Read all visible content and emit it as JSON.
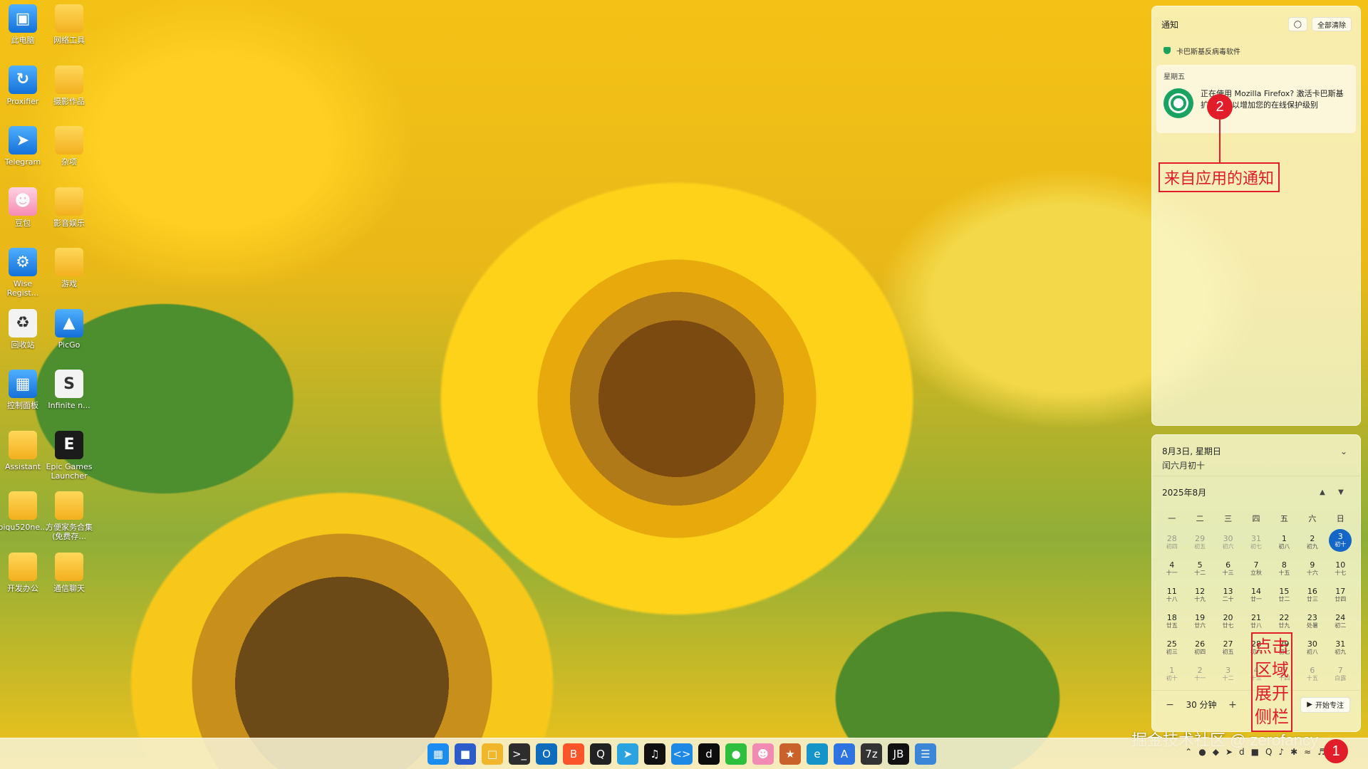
{
  "desktop": {
    "icons": [
      {
        "label": "此电脑",
        "icon": "computer-icon"
      },
      {
        "label": "网络工具",
        "icon": "folder-icon"
      },
      {
        "label": "Proxifier",
        "icon": "proxifier-icon"
      },
      {
        "label": "摄影作品",
        "icon": "folder-icon"
      },
      {
        "label": "Telegram",
        "icon": "telegram-icon"
      },
      {
        "label": "杂项",
        "icon": "folder-icon"
      },
      {
        "label": "豆包",
        "icon": "doubao-icon"
      },
      {
        "label": "影音娱乐",
        "icon": "folder-icon"
      },
      {
        "label": "Wise Regist...",
        "icon": "wise-registry-icon"
      },
      {
        "label": "游戏",
        "icon": "folder-icon"
      },
      {
        "label": "回收站",
        "icon": "recycle-bin-icon"
      },
      {
        "label": "PicGo",
        "icon": "picgo-icon"
      },
      {
        "label": "控制面板",
        "icon": "control-panel-icon"
      },
      {
        "label": "Infinite n...",
        "icon": "infinite-icon"
      },
      {
        "label": "Assistant",
        "icon": "folder-icon"
      },
      {
        "label": "Epic Games Launcher",
        "icon": "epic-games-icon"
      },
      {
        "label": "biqu520ne...",
        "icon": "folder-icon"
      },
      {
        "label": "方便家务合集 (免费存...",
        "icon": "folder-icon"
      },
      {
        "label": "开发办公",
        "icon": "folder-icon"
      },
      {
        "label": "通信聊天",
        "icon": "folder-icon"
      }
    ]
  },
  "notifications": {
    "title": "通知",
    "clear_all": "全部清除",
    "app_name": "卡巴斯基反病毒软件",
    "card": {
      "day": "星期五",
      "text": "正在使用 Mozilla Firefox? 激活卡巴斯基扩展程序以增加您的在线保护级别"
    }
  },
  "annotations": {
    "badge_2": "2",
    "notif_callout": "来自应用的通知",
    "expand_callout": "点击区域展开侧栏",
    "badge_1": "1",
    "color": "#e11d2a"
  },
  "calendar": {
    "date": "8月3日, 星期日",
    "lunar": "闰六月初十",
    "month": "2025年8月",
    "weekdays": [
      "一",
      "二",
      "三",
      "四",
      "五",
      "六",
      "日"
    ],
    "weeks": [
      [
        [
          "28",
          "初四",
          1
        ],
        [
          "29",
          "初五",
          1
        ],
        [
          "30",
          "初六",
          1
        ],
        [
          "31",
          "初七",
          1
        ],
        [
          "1",
          "初八",
          0
        ],
        [
          "2",
          "初九",
          0
        ],
        [
          "3",
          "初十",
          2
        ]
      ],
      [
        [
          "4",
          "十一",
          0
        ],
        [
          "5",
          "十二",
          0
        ],
        [
          "6",
          "十三",
          0
        ],
        [
          "7",
          "立秋",
          0
        ],
        [
          "8",
          "十五",
          0
        ],
        [
          "9",
          "十六",
          0
        ],
        [
          "10",
          "十七",
          0
        ]
      ],
      [
        [
          "11",
          "十八",
          0
        ],
        [
          "12",
          "十九",
          0
        ],
        [
          "13",
          "二十",
          0
        ],
        [
          "14",
          "廿一",
          0
        ],
        [
          "15",
          "廿二",
          0
        ],
        [
          "16",
          "廿三",
          0
        ],
        [
          "17",
          "廿四",
          0
        ]
      ],
      [
        [
          "18",
          "廿五",
          0
        ],
        [
          "19",
          "廿六",
          0
        ],
        [
          "20",
          "廿七",
          0
        ],
        [
          "21",
          "廿八",
          0
        ],
        [
          "22",
          "廿九",
          0
        ],
        [
          "23",
          "处暑",
          0
        ],
        [
          "24",
          "初二",
          0
        ]
      ],
      [
        [
          "25",
          "初三",
          0
        ],
        [
          "26",
          "初四",
          0
        ],
        [
          "27",
          "初五",
          0
        ],
        [
          "28",
          "初六",
          0
        ],
        [
          "29",
          "初七",
          0
        ],
        [
          "30",
          "初八",
          0
        ],
        [
          "31",
          "初九",
          0
        ]
      ],
      [
        [
          "1",
          "初十",
          1
        ],
        [
          "2",
          "十一",
          1
        ],
        [
          "3",
          "十二",
          1
        ],
        [
          "4",
          "十三",
          1
        ],
        [
          "5",
          "十四",
          1
        ],
        [
          "6",
          "十五",
          1
        ],
        [
          "7",
          "白露",
          1
        ]
      ]
    ],
    "focus_time": "30 分钟",
    "focus_start": "开始专注",
    "accent": "#1467c7"
  },
  "taskbar": {
    "apps": [
      "windows-start-icon",
      "store-icon",
      "file-explorer-icon",
      "terminal-icon",
      "outlook-icon",
      "brave-icon",
      "qq-icon",
      "telegram-icon",
      "tiktok-icon",
      "vscode-icon",
      "douyin-icon",
      "wechat-icon",
      "doubao-icon",
      "fox-icon",
      "edge-icon",
      "app-store-icon",
      "7zip-icon",
      "jetbrains-icon",
      "notepad-icon"
    ],
    "tray_icons": [
      "chevron-up-icon",
      "firefox-icon",
      "vpn-icon",
      "telegram-icon",
      "douyin-icon",
      "app-icon",
      "qq-icon",
      "speaker-mute-icon",
      "bluetooth-icon",
      "wifi-icon",
      "volume-icon"
    ]
  },
  "watermark": "掘金技术社区 @ zerofancy"
}
